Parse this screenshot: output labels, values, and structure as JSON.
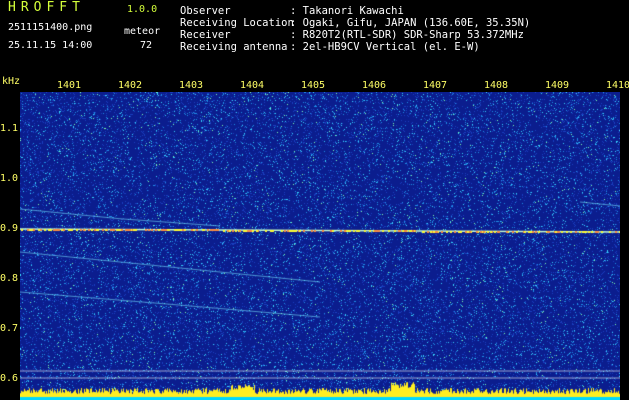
{
  "app": {
    "name": "HROFFT",
    "version": "1.0.0"
  },
  "file": {
    "name": "2511151400.png",
    "datetime": "25.11.15 14:00"
  },
  "detector": {
    "label": "meteor",
    "count": "72"
  },
  "info": [
    {
      "key": "Observer",
      "value": ": Takanori Kawachi"
    },
    {
      "key": "Receiving Location",
      "value": ": Ogaki, Gifu, JAPAN (136.60E, 35.35N)"
    },
    {
      "key": "Receiver",
      "value": ": R820T2(RTL-SDR) SDR-Sharp 53.372MHz"
    },
    {
      "key": "Receiving antenna",
      "value": ": 2el-HB9CV Vertical (el. E-W)"
    }
  ],
  "spectrogram": {
    "y_unit": "kHz",
    "y_ticks": [
      "1.1",
      "1.0",
      "0.9",
      "0.8",
      "0.7",
      "0.6"
    ],
    "x_ticks": [
      "1401",
      "1402",
      "1403",
      "1404",
      "1405",
      "1406",
      "1407",
      "1408",
      "1409",
      "1410"
    ],
    "colors": {
      "background": "#0a1a8c",
      "noise": "#1fa0ff",
      "signal": "#ffff33",
      "baseline": "#00d8ff"
    }
  }
}
